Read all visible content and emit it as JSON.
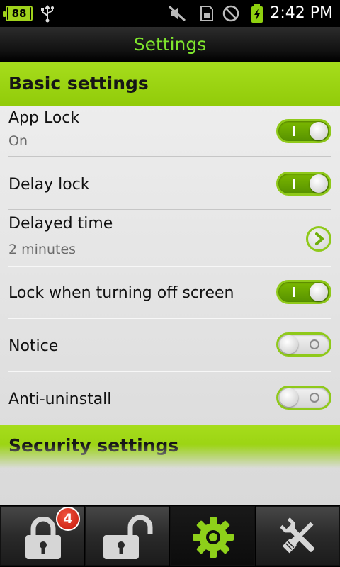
{
  "status_bar": {
    "battery_level": "88",
    "time": "2:42 PM",
    "icons": [
      "battery-icon",
      "usb-icon",
      "muted-icon",
      "sim-icon",
      "blocked-icon",
      "charging-battery-icon"
    ]
  },
  "title_bar": {
    "title": "Settings"
  },
  "sections": {
    "basic": {
      "header": "Basic settings",
      "items": [
        {
          "title": "App Lock",
          "summary": "On",
          "control": "toggle",
          "state": "on"
        },
        {
          "title": "Delay lock",
          "control": "toggle",
          "state": "on"
        },
        {
          "title": "Delayed time",
          "summary": "2 minutes",
          "control": "chevron"
        },
        {
          "title": "Lock when turning off screen",
          "control": "toggle",
          "state": "on"
        },
        {
          "title": "Notice",
          "control": "toggle",
          "state": "off"
        },
        {
          "title": "Anti-uninstall",
          "control": "toggle",
          "state": "off"
        }
      ]
    },
    "security": {
      "header": "Security settings"
    }
  },
  "tab_bar": {
    "tabs": [
      {
        "icon": "locked-padlock-icon",
        "badge": "4",
        "active": false
      },
      {
        "icon": "unlocked-padlock-icon",
        "active": false
      },
      {
        "icon": "gear-icon",
        "active": true
      },
      {
        "icon": "tools-icon",
        "active": false
      }
    ]
  },
  "colors": {
    "accent": "#97d00e",
    "title_text": "#7fe52d",
    "badge": "#d9261a"
  }
}
